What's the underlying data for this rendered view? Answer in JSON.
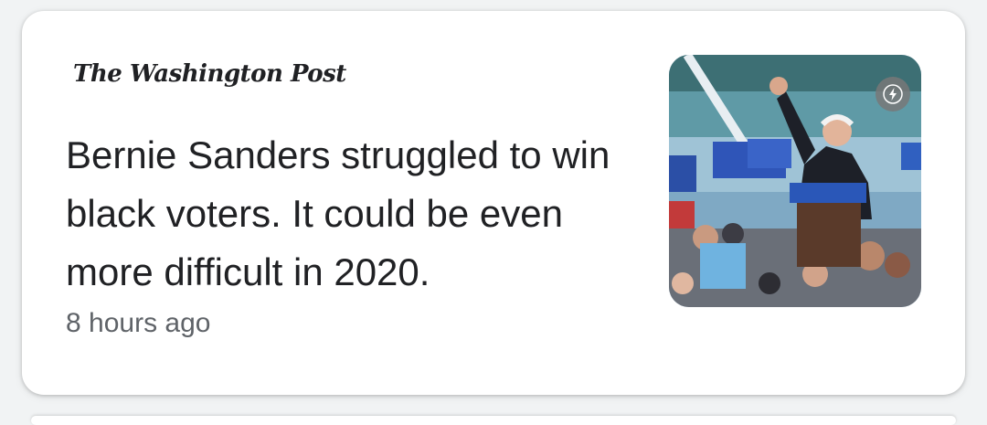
{
  "article": {
    "publisher": "The Washington Post",
    "headline": "Bernie Sanders struggled to win black voters. It could be even more difficult in 2020.",
    "timestamp": "8 hours ago",
    "thumbnail_icon": "news-photo",
    "badge_icon": "amp-lightning-icon"
  },
  "colors": {
    "card_bg": "#ffffff",
    "headline": "#202124",
    "timestamp": "#5f6368",
    "page_bg": "#f1f3f4"
  }
}
